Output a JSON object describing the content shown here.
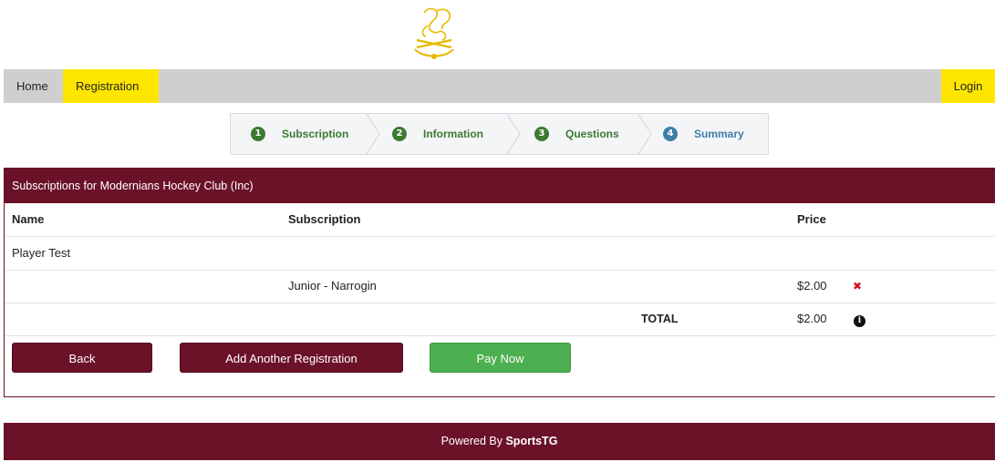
{
  "nav": {
    "home": "Home",
    "registration": "Registration",
    "login": "Login"
  },
  "steps": [
    {
      "num": "1",
      "label": "Subscription"
    },
    {
      "num": "2",
      "label": "Information"
    },
    {
      "num": "3",
      "label": "Questions"
    },
    {
      "num": "4",
      "label": "Summary"
    }
  ],
  "panel": {
    "title": "Subscriptions for Modernians Hockey Club (Inc)",
    "headers": {
      "name": "Name",
      "subscription": "Subscription",
      "price": "Price"
    },
    "player_name": "Player Test",
    "item": {
      "subscription": "Junior - Narrogin",
      "price": "$2.00"
    },
    "total_label": "TOTAL",
    "total_price": "$2.00"
  },
  "buttons": {
    "back": "Back",
    "add_another": "Add Another Registration",
    "pay_now": "Pay Now"
  },
  "footer": {
    "prefix": "Powered By",
    "brand": "SportsTG"
  },
  "colors": {
    "maroon": "#6b1228",
    "yellow": "#ffe600",
    "green": "#4caf50",
    "step_done": "#3c7a32",
    "step_active": "#3e7fa5"
  }
}
